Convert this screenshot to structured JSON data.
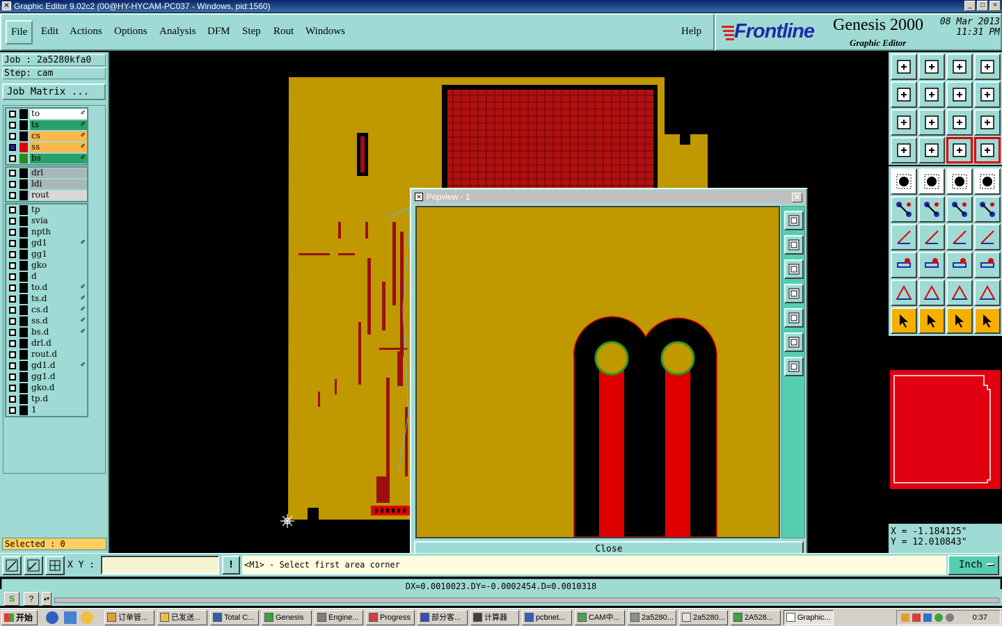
{
  "window": {
    "title": "Graphic Editor 9.02c2 (00@HY-HYCAM-PC037 - Windows, pid:1560)",
    "controls": [
      "_",
      "□",
      "×"
    ]
  },
  "menu": [
    "File",
    "Edit",
    "Actions",
    "Options",
    "Analysis",
    "DFM",
    "Step",
    "Rout",
    "Windows"
  ],
  "help": "Help",
  "logo": {
    "brand": "Frontline",
    "product": "Genesis 2000",
    "subtitle": "Graphic Editor",
    "date": "08 Mar 2013",
    "time": "11:31 PM"
  },
  "job": {
    "job_label": "Job : 2a5280kfa0",
    "step_label": "Step: cam",
    "matrix_button": "Job Matrix ..."
  },
  "layers": {
    "board": [
      {
        "name": "to",
        "color": "#ffffff",
        "swatch": "",
        "affected": true
      },
      {
        "name": "ts",
        "color": "#2aa06a",
        "swatch": "",
        "affected": true
      },
      {
        "name": "cs",
        "color": "#ffb84a",
        "swatch": "",
        "affected": true
      },
      {
        "name": "ss",
        "color": "#ffb84a",
        "swatch": "#e00000",
        "affected": true,
        "work": true
      },
      {
        "name": "bs",
        "color": "#2aa06a",
        "swatch": "#2a8a20",
        "affected": true
      }
    ],
    "drill": [
      {
        "name": "drl",
        "color": "#a8b8b8"
      },
      {
        "name": "ldi",
        "color": "#a8b8b8"
      },
      {
        "name": "rout",
        "color": "#d8d8d8"
      }
    ],
    "misc": [
      {
        "name": "tp",
        "affected": false
      },
      {
        "name": "svia",
        "affected": false
      },
      {
        "name": "npth",
        "affected": false
      },
      {
        "name": "gd1",
        "affected": true
      },
      {
        "name": "gg1",
        "affected": false
      },
      {
        "name": "gko",
        "affected": false
      },
      {
        "name": "d",
        "affected": false
      },
      {
        "name": "to.d",
        "affected": true
      },
      {
        "name": "ts.d",
        "affected": true
      },
      {
        "name": "cs.d",
        "affected": true
      },
      {
        "name": "ss.d",
        "affected": true
      },
      {
        "name": "bs.d",
        "affected": true
      },
      {
        "name": "drl.d",
        "affected": false
      },
      {
        "name": "rout.d",
        "affected": false
      },
      {
        "name": "gd1.d",
        "affected": true
      },
      {
        "name": "gg1.d",
        "affected": false
      },
      {
        "name": "gko.d",
        "affected": false
      },
      {
        "name": "tp.d",
        "affected": false
      },
      {
        "name": "1",
        "affected": false
      }
    ]
  },
  "selected": "Selected : 0",
  "popview": {
    "title": "Popview - 1",
    "close": "Close",
    "tools": [
      "zoom-window-icon",
      "pan-up-icon",
      "pan-down-icon",
      "pan-left-icon",
      "pan-right-icon",
      "zoom-out-icon",
      "zoom-in-icon"
    ]
  },
  "toolbar_top": [
    "page-up-icon",
    "page-down-icon",
    "home-icon",
    "split-view-icon",
    "prev-icon",
    "next-icon",
    "undo-view-icon",
    "redraw-icon",
    "fit-icon",
    "zoom-icon",
    "scale-1-2-icon",
    "help-icon",
    "tools-icon",
    "grid-icon",
    "snap-icon",
    "snap-toggle-icon"
  ],
  "toolbar_bottom": [
    "add-pad-icon",
    "add-line-icon",
    "ruler-icon",
    "dot-icon",
    "connect-icon",
    "delete-node-icon",
    "move-node-icon",
    "edit-node-icon",
    "draw-arc-icon",
    "draw-line-icon",
    "rotate-icon",
    "mirror-icon",
    "select-pad-icon",
    "cut-line-icon",
    "measure-icon",
    "copy-pad-icon",
    "poly-icon",
    "poly-outline-icon",
    "poly-fill-icon",
    "poly-cut-icon",
    "select-icon",
    "select-box-icon",
    "select-point-icon",
    "select-net-icon"
  ],
  "coords": {
    "x": "X  =  -1.184125\"",
    "y": "Y  =  12.010843\""
  },
  "cmd": {
    "xy_label": "X Y :",
    "xy_value": "",
    "warn": "!",
    "prompt": "<M1> - Select first area corner",
    "unit": "Inch"
  },
  "status": "DX=0.0010023,DY=-0.0002454,D=0.0010318",
  "taskbar": {
    "start": "开始",
    "tasks": [
      "订单管...",
      "已发送...",
      "Total C...",
      "Genesis",
      "Engine...",
      "Progress",
      "部分客...",
      "计算器",
      "pcbnet...",
      "CAM中...",
      "2a5280...",
      "2a5280...",
      "2A528...",
      "Graphic..."
    ],
    "clock": "0:37"
  },
  "colors": {
    "panel": "#9fdad5",
    "board": "#c09800",
    "copper": "#e00000",
    "accent": "#55ceb0"
  }
}
